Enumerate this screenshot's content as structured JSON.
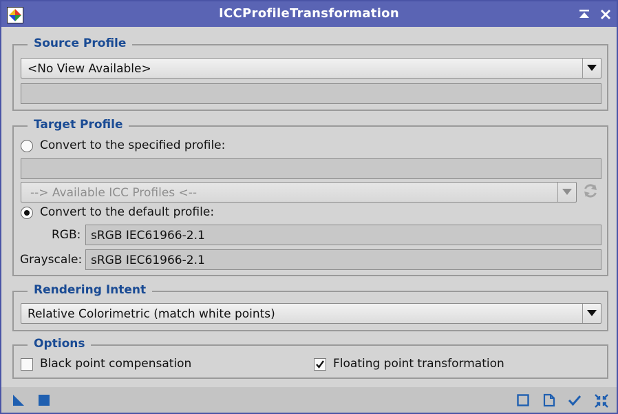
{
  "window": {
    "title": "ICCProfileTransformation"
  },
  "source_profile": {
    "legend": "Source Profile",
    "view_selected": "<No View Available>",
    "profile_description": ""
  },
  "target_profile": {
    "legend": "Target Profile",
    "specified_label": "Convert to the specified profile:",
    "specified_checked": false,
    "specified_value": "",
    "available_profiles": "--> Available ICC Profiles <--",
    "default_label": "Convert to the default profile:",
    "default_checked": true,
    "rgb_label": "RGB:",
    "rgb_value": "sRGB IEC61966-2.1",
    "grayscale_label": "Grayscale:",
    "grayscale_value": "sRGB IEC61966-2.1"
  },
  "rendering_intent": {
    "legend": "Rendering Intent",
    "selected": "Relative Colorimetric (match white points)"
  },
  "options": {
    "legend": "Options",
    "black_point_label": "Black point compensation",
    "black_point_checked": false,
    "floating_point_label": "Floating point transformation",
    "floating_point_checked": true
  },
  "colors": {
    "title_bar": "#5a64b4",
    "legend_text": "#1a4b94",
    "icon_accent": "#1f5fb0",
    "background": "#d4d4d4"
  },
  "icons": {
    "title_bar": [
      "app-icon",
      "shade-icon",
      "close-icon"
    ],
    "status_bar_left": [
      "new-instance-icon",
      "apply-global-icon"
    ],
    "status_bar_right": [
      "preview-icon",
      "documentation-icon",
      "apply-icon",
      "reset-icon"
    ],
    "refresh": "refresh-icon"
  }
}
